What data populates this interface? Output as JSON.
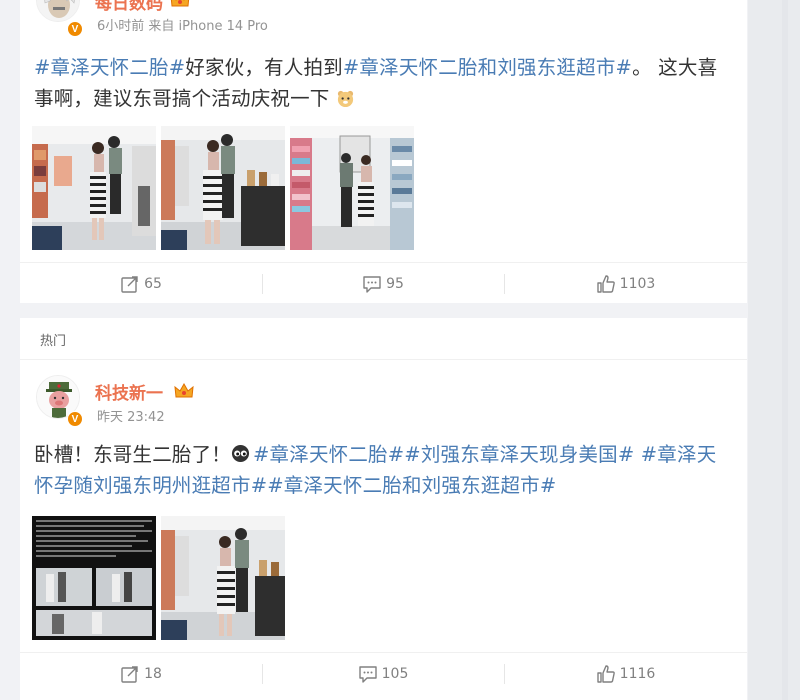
{
  "post1": {
    "username": "每日数码",
    "meta_time": "6小时前",
    "meta_source": "来自 iPhone 14 Pro",
    "content_line1": [
      {
        "type": "tag",
        "text": "#章泽天怀二胎#"
      },
      {
        "type": "text",
        "text": "好家伙，有人拍到"
      },
      {
        "type": "tag",
        "text": "#章泽天怀二胎和刘强东逛超市#"
      },
      {
        "type": "text",
        "text": "。 这大喜"
      }
    ],
    "content_line2": "事啊，建议东哥搞个活动庆祝一下",
    "emoji": "bear-face-emoji",
    "images": [
      "supermarket-photo-1",
      "supermarket-photo-2",
      "supermarket-photo-3"
    ],
    "actions": {
      "repost": "65",
      "comment": "95",
      "like": "1103"
    }
  },
  "post2": {
    "section_label": "热门",
    "username": "科技新一",
    "meta_time": "昨天 23:42",
    "content_line1_text": "卧槽！东哥生二胎了！",
    "emoji": "eyes-emoji",
    "content_line1_tags": "#章泽天怀二胎##刘强东章泽天现身美国# #章泽天",
    "content_line2_tag": "怀孕随刘强东明州逛超市##章泽天怀二胎和刘强东逛超市#",
    "images": [
      "screenshot-collage",
      "supermarket-photo-4"
    ],
    "actions": {
      "repost": "18",
      "comment": "105",
      "like": "1116"
    }
  },
  "icons": {
    "repost": "repost-icon",
    "comment": "comment-icon",
    "like": "like-icon",
    "verified": "verified-badge-icon",
    "crown": "vip-crown-icon"
  },
  "colors": {
    "username": "#eb7350",
    "tag": "#4a7cb4",
    "meta": "#939393",
    "action": "#808080",
    "badge": "#f08a00"
  }
}
